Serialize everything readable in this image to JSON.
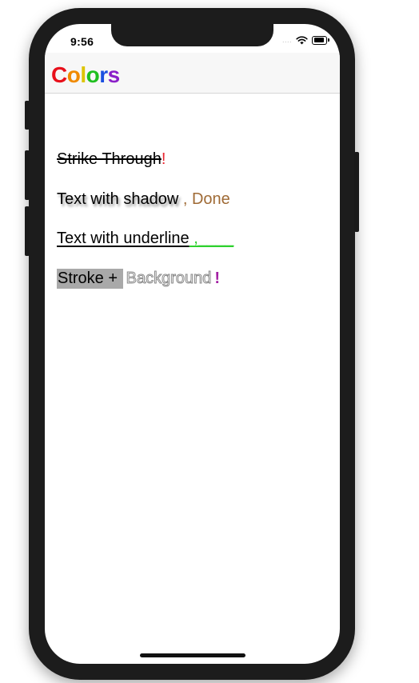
{
  "status_bar": {
    "time": "9:56",
    "signal": "....",
    "icons": [
      "wifi-icon",
      "battery-icon"
    ]
  },
  "nav": {
    "title_letters": [
      {
        "char": "C",
        "color": "#e8101b"
      },
      {
        "char": "o",
        "color": "#f08a00"
      },
      {
        "char": "l",
        "color": "#ddc400"
      },
      {
        "char": "o",
        "color": "#1fbf1f"
      },
      {
        "char": "r",
        "color": "#1a4fe0"
      },
      {
        "char": "s",
        "color": "#8a1fc8"
      }
    ]
  },
  "lines": {
    "strike": {
      "text": "Strike Through",
      "suffix": "!",
      "suffix_color": "#e8242f"
    },
    "shadow": {
      "text": "Text with shadow",
      "suffix": " , Done",
      "suffix_color": "#9f6a35"
    },
    "underline": {
      "text": "Text with underline",
      "suffix": " ,____",
      "suffix_color": "#2ed12e"
    },
    "stroke": {
      "text": "Stroke + ",
      "outline_text": "Background",
      "suffix": "!",
      "suffix_color": "#a21fa2",
      "background_color": "#a9a9a9"
    }
  }
}
